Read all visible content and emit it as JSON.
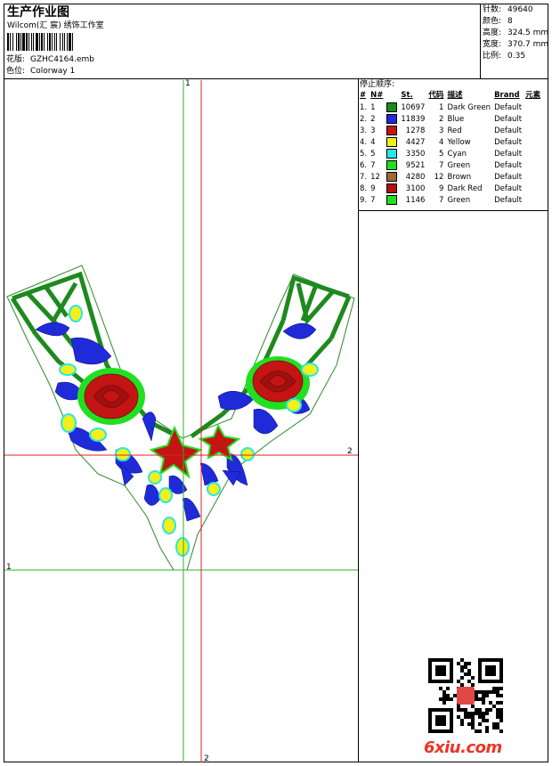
{
  "header": {
    "title": "生产作业图",
    "studio": "Wilcom(汇 宸) 绣饰工作室",
    "design_label": "花版:",
    "design_value": "GZHC4164.emb",
    "colorway_label": "色位:",
    "colorway_value": "Colorway 1"
  },
  "stats": [
    {
      "label": "针数:",
      "value": "49640"
    },
    {
      "label": "颜色:",
      "value": "8"
    },
    {
      "label": "高度:",
      "value": "324.5 mm"
    },
    {
      "label": "宽度:",
      "value": "370.7 mm"
    },
    {
      "label": "比例:",
      "value": "0.35"
    }
  ],
  "stop_sequence": {
    "title": "停止顺序:",
    "columns": [
      "#",
      "N#",
      "St.",
      "代码",
      "描述",
      "Brand",
      "元素"
    ],
    "rows": [
      {
        "idx": "1.",
        "n": "1",
        "color": "#1a8a1a",
        "st": "10697",
        "code": "1",
        "desc": "Dark Green",
        "brand": "Default"
      },
      {
        "idx": "2.",
        "n": "2",
        "color": "#1f2bd9",
        "st": "11839",
        "code": "2",
        "desc": "Blue",
        "brand": "Default"
      },
      {
        "idx": "3.",
        "n": "3",
        "color": "#c41414",
        "st": "1278",
        "code": "3",
        "desc": "Red",
        "brand": "Default"
      },
      {
        "idx": "4.",
        "n": "4",
        "color": "#f0f01a",
        "st": "4427",
        "code": "4",
        "desc": "Yellow",
        "brand": "Default"
      },
      {
        "idx": "5.",
        "n": "5",
        "color": "#28e6e6",
        "st": "3350",
        "code": "5",
        "desc": "Cyan",
        "brand": "Default"
      },
      {
        "idx": "6.",
        "n": "7",
        "color": "#20e020",
        "st": "9521",
        "code": "7",
        "desc": "Green",
        "brand": "Default"
      },
      {
        "idx": "7.",
        "n": "12",
        "color": "#9a6a3a",
        "st": "4280",
        "code": "12",
        "desc": "Brown",
        "brand": "Default"
      },
      {
        "idx": "8.",
        "n": "9",
        "color": "#b01010",
        "st": "3100",
        "code": "9",
        "desc": "Dark Red",
        "brand": "Default"
      },
      {
        "idx": "9.",
        "n": "7",
        "color": "#20e020",
        "st": "1146",
        "code": "7",
        "desc": "Green",
        "brand": "Default"
      }
    ]
  },
  "axis_labels": {
    "green_v": "1",
    "green_h": "1",
    "red_h": "2",
    "red_v": "2"
  },
  "watermark": {
    "text": "6xiu.com",
    "color": "#ee3322"
  }
}
